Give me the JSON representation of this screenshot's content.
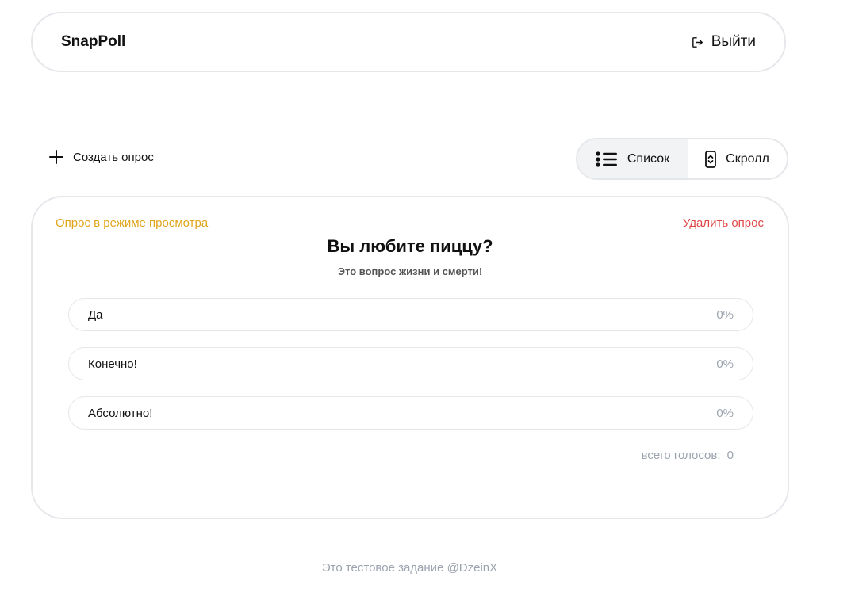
{
  "header": {
    "brand": "SnapPoll",
    "logout_label": "Выйти",
    "logout_icon": "logout-icon"
  },
  "toolbar": {
    "create_label": "Создать опрос",
    "create_icon": "plus-icon",
    "view_modes": [
      {
        "label": "Список",
        "icon": "list-icon",
        "active": true
      },
      {
        "label": "Скролл",
        "icon": "scroll-icon",
        "active": false
      }
    ]
  },
  "poll": {
    "mode_label": "Опрос в режиме просмотра",
    "delete_label": "Удалить опрос",
    "title": "Вы любите пиццу?",
    "subtitle": "Это вопрос жизни и смерти!",
    "options": [
      {
        "label": "Да",
        "percent": "0%",
        "fraction": 0
      },
      {
        "label": "Конечно!",
        "percent": "0%",
        "fraction": 0
      },
      {
        "label": "Абсолютно!",
        "percent": "0%",
        "fraction": 0
      }
    ],
    "total_votes_label": "всего голосов:",
    "total_votes_value": "0"
  },
  "footer": {
    "text": "Это тестовое задание @DzeinX"
  },
  "colors": {
    "mode_label": "#e0a51a",
    "delete": "#e04848",
    "muted": "#9ca3af",
    "border": "#e5e7eb",
    "active_toggle_bg": "#f2f3f5"
  }
}
